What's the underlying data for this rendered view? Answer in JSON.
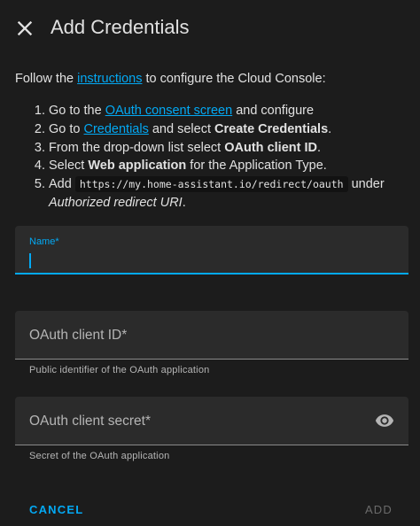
{
  "dialog": {
    "title": "Add Credentials",
    "close_icon": "close-icon"
  },
  "intro": {
    "before": "Follow the ",
    "link": "instructions",
    "after": " to configure the Cloud Console:"
  },
  "steps": {
    "s1": {
      "before": "Go to the ",
      "link": "OAuth consent screen",
      "after": " and configure"
    },
    "s2": {
      "before": "Go to ",
      "link": "Credentials",
      "mid": " and select ",
      "bold": "Create Credentials",
      "after": "."
    },
    "s3": {
      "before": "From the drop-down list select ",
      "bold": "OAuth client ID",
      "after": "."
    },
    "s4": {
      "before": "Select ",
      "bold": "Web application",
      "after": " for the Application Type."
    },
    "s5": {
      "before": "Add ",
      "code": "https://my.home-assistant.io/redirect/oauth",
      "mid": " under ",
      "italic": "Authorized redirect URI",
      "after": "."
    }
  },
  "fields": {
    "name": {
      "label": "Name*",
      "value": ""
    },
    "client_id": {
      "label": "OAuth client ID*",
      "helper": "Public identifier of the OAuth application"
    },
    "client_secret": {
      "label": "OAuth client secret*",
      "helper": "Secret of the OAuth application",
      "icon": "eye-icon"
    }
  },
  "actions": {
    "cancel": "CANCEL",
    "add": "ADD"
  },
  "colors": {
    "background": "#1c1c1c",
    "accent": "#03a9f4",
    "field": "#2b2b2b",
    "disabled": "#6b6b6b"
  }
}
